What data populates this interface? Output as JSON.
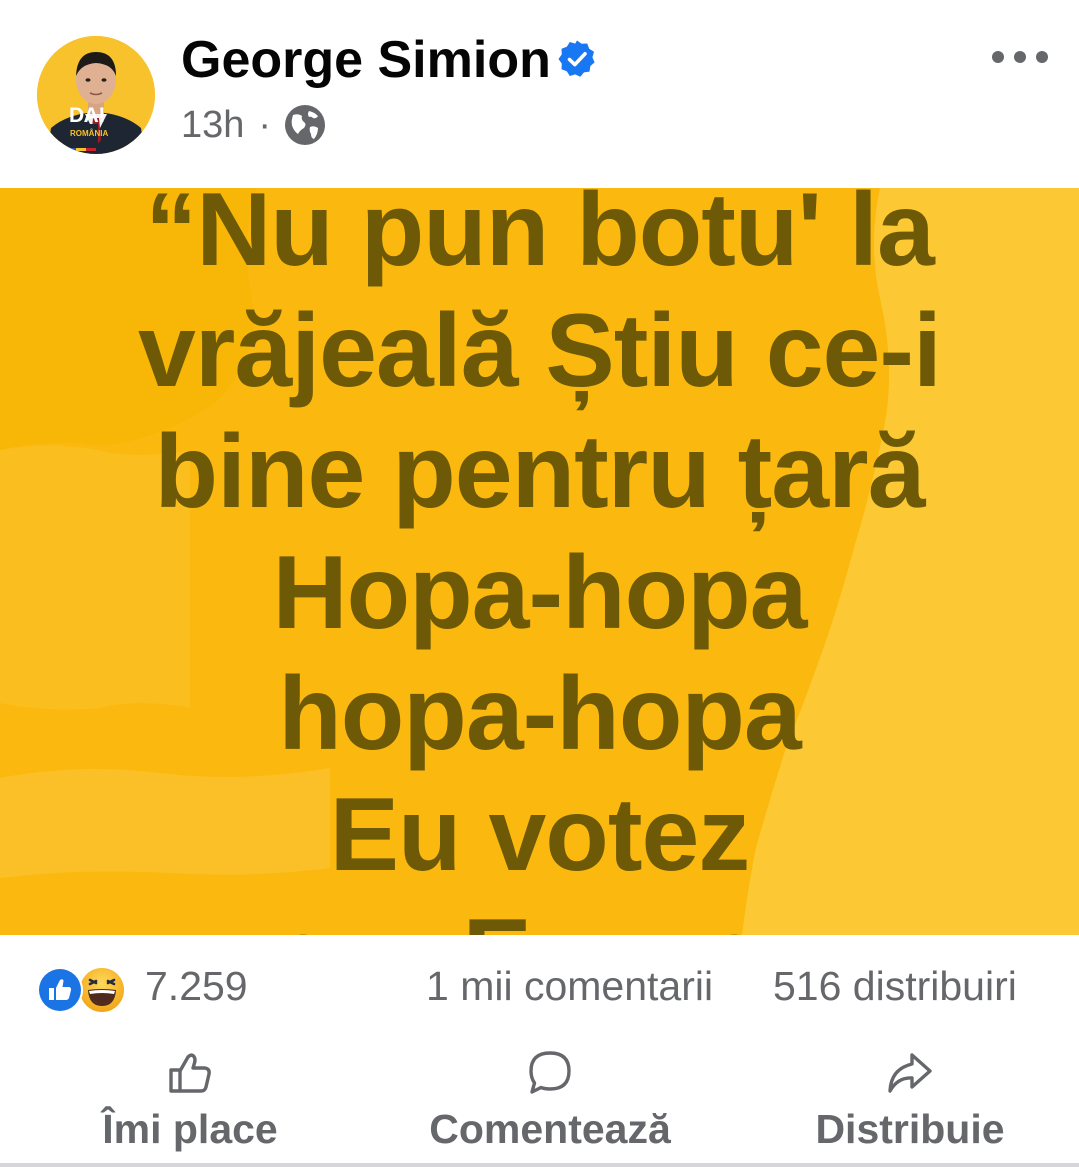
{
  "header": {
    "author_name": "George Simion",
    "verified": true,
    "timestamp": "13h",
    "separator": "·",
    "audience_icon": "globe-icon",
    "more_icon": "more-options-icon",
    "avatar": {
      "badge_text": "DA!",
      "badge_subtext": "ROMÂNIA"
    }
  },
  "post_image": {
    "background_color": "#fbb910",
    "text_color": "#6e5a06",
    "lines": [
      "“Nu pun botu' la",
      "vrăjeală Știu ce-i",
      "bine pentru țară",
      "Hopa-hopa",
      "hopa-hopa",
      "Eu votez",
      "pro-Europa"
    ]
  },
  "stats": {
    "reactions": [
      "like-reaction-icon",
      "haha-reaction-icon"
    ],
    "reaction_count": "7.259",
    "comments": "1 mii comentarii",
    "shares": "516 distribuiri"
  },
  "actions": {
    "like_label": "Îmi place",
    "comment_label": "Comentează",
    "share_label": "Distribuie"
  },
  "colors": {
    "accent_blue": "#1877f2",
    "secondary_text": "#65676b",
    "yellow": "#fbb910"
  }
}
